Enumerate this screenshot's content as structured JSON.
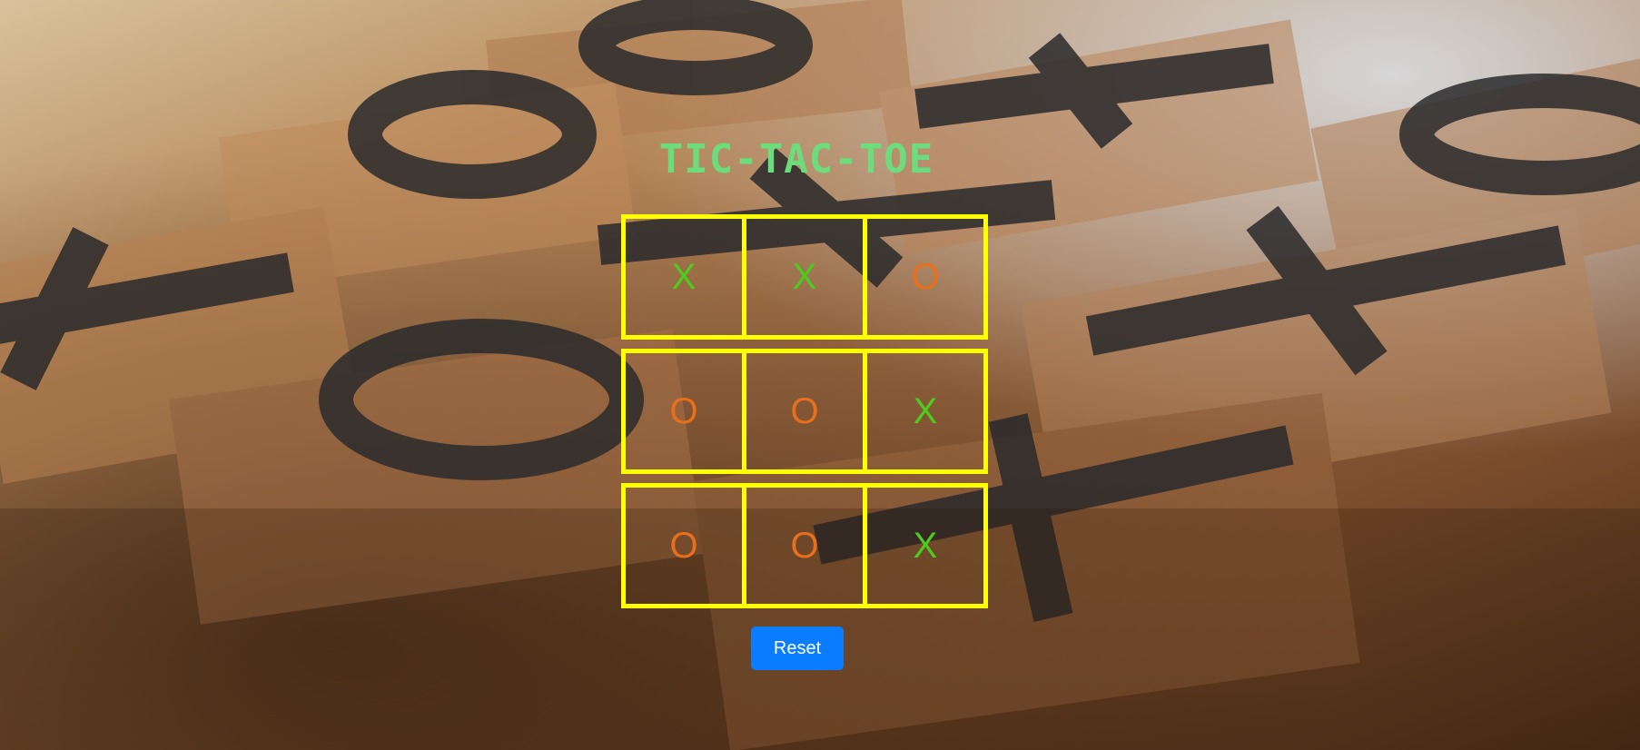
{
  "page": {
    "title": "TIC-TAC-TOE",
    "background_image": "wooden tic-tac-toe pieces photo"
  },
  "board": {
    "rows": [
      [
        {
          "mark": "X"
        },
        {
          "mark": "X"
        },
        {
          "mark": "O"
        }
      ],
      [
        {
          "mark": "O"
        },
        {
          "mark": "O"
        },
        {
          "mark": "X"
        }
      ],
      [
        {
          "mark": "O"
        },
        {
          "mark": "O"
        },
        {
          "mark": "X"
        }
      ]
    ],
    "grid_color": "#ffff00",
    "x_color": "#4ccc1c",
    "o_color": "#e8701c"
  },
  "controls": {
    "reset_label": "Reset",
    "reset_color": "#0a7cff"
  }
}
